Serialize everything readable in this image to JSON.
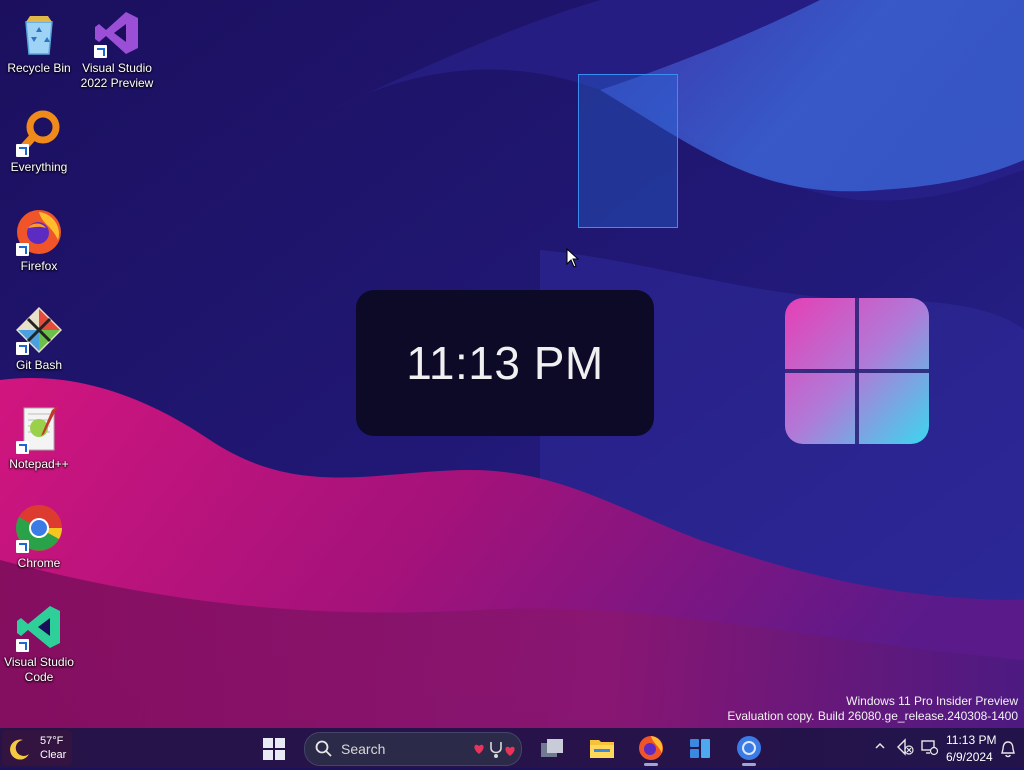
{
  "desktop": {
    "icons": [
      {
        "label": "Recycle Bin"
      },
      {
        "label": "Visual Studio 2022 Preview"
      },
      {
        "label": "Everything"
      },
      {
        "label": "Firefox"
      },
      {
        "label": "Git Bash"
      },
      {
        "label": "Notepad++"
      },
      {
        "label": "Chrome"
      },
      {
        "label": "Visual Studio Code"
      }
    ]
  },
  "clock_widget": {
    "time": "11:13 PM"
  },
  "watermark": {
    "line1": "Windows 11 Pro Insider Preview",
    "line2": "Evaluation copy. Build 26080.ge_release.240308-1400"
  },
  "taskbar": {
    "weather": {
      "temp": "57°F",
      "condition": "Clear",
      "icon": "moon-icon"
    },
    "search": {
      "placeholder": "Search"
    },
    "apps": [
      "task-view",
      "file-explorer",
      "firefox",
      "widgets",
      "chrome"
    ],
    "tray": {
      "time": "11:13 PM",
      "date": "6/9/2024"
    }
  },
  "colors": {
    "wallpaper_dark": "#1a0d5a",
    "wallpaper_magenta": "#c2127a",
    "wallpaper_blue": "#3a5fd0",
    "taskbar_bg": "#1e1446",
    "selection": "#3a8ef0"
  }
}
